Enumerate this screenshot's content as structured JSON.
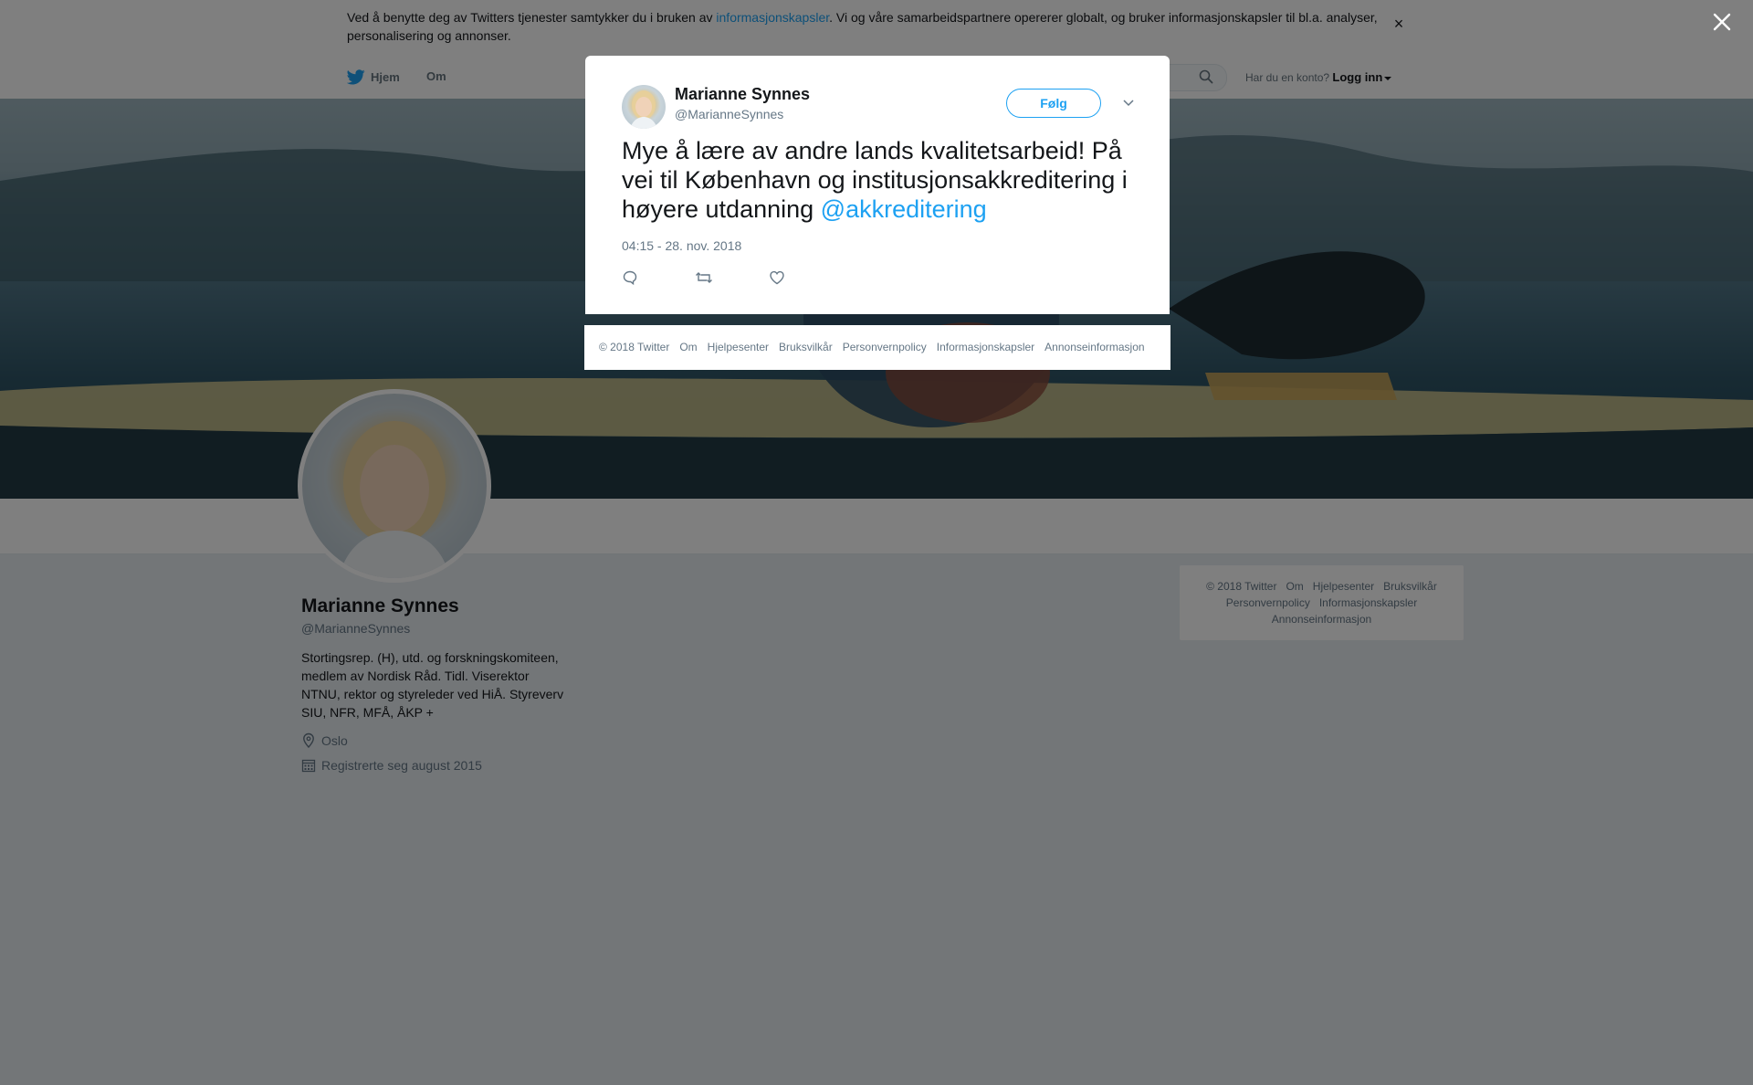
{
  "cookie_banner": {
    "text_before": "Ved å benytte deg av Twitters tjenester samtykker du i bruken av ",
    "link": "informasjonskapsler",
    "text_after": ". Vi og våre samarbeidspartnere opererer globalt, og bruker informasjonskapsler til bl.a. analyser, personalisering og annonser.",
    "close": "×"
  },
  "nav": {
    "home": "Hjem",
    "about": "Om",
    "account_prompt": "Har du en konto?",
    "login": "Logg inn"
  },
  "profile": {
    "name": "Marianne Synnes",
    "handle": "@MarianneSynnes",
    "bio": "Stortingsrep. (H), utd. og forskningskomiteen, medlem av Nordisk Råd. Tidl. Viserektor NTNU, rektor og styreleder ved HiÅ. Styreverv SIU, NFR, MFÅ, ÅKP +",
    "location": "Oslo",
    "joined": "Registrerte seg august 2015"
  },
  "side_footer": {
    "items": [
      "© 2018 Twitter",
      "Om",
      "Hjelpesenter",
      "Bruksvilkår",
      "Personvernpolicy",
      "Informasjonskapsler",
      "Annonseinformasjon"
    ]
  },
  "tweet_modal": {
    "name": "Marianne Synnes",
    "handle": "@MarianneSynnes",
    "follow": "Følg",
    "text": "Mye å lære av andre lands kvalitetsarbeid! På vei til København og institusjonsakkreditering i høyere utdanning ",
    "mention": "@akkreditering",
    "timestamp": "04:15 - 28. nov. 2018"
  },
  "modal_footer": {
    "items": [
      "© 2018 Twitter",
      "Om",
      "Hjelpesenter",
      "Bruksvilkår",
      "Personvernpolicy",
      "Informasjonskapsler",
      "Annonseinformasjon"
    ]
  },
  "colors": {
    "accent": "#1da1f2",
    "text": "#14171a",
    "muted": "#657786",
    "background": "#e6ecf0"
  },
  "icons": {
    "twitter": "twitter-bird-icon",
    "search": "search-icon",
    "close": "close-icon",
    "location": "location-pin-icon",
    "calendar": "calendar-icon",
    "more": "chevron-down-icon",
    "reply": "reply-icon",
    "retweet": "retweet-icon",
    "like": "heart-icon"
  }
}
